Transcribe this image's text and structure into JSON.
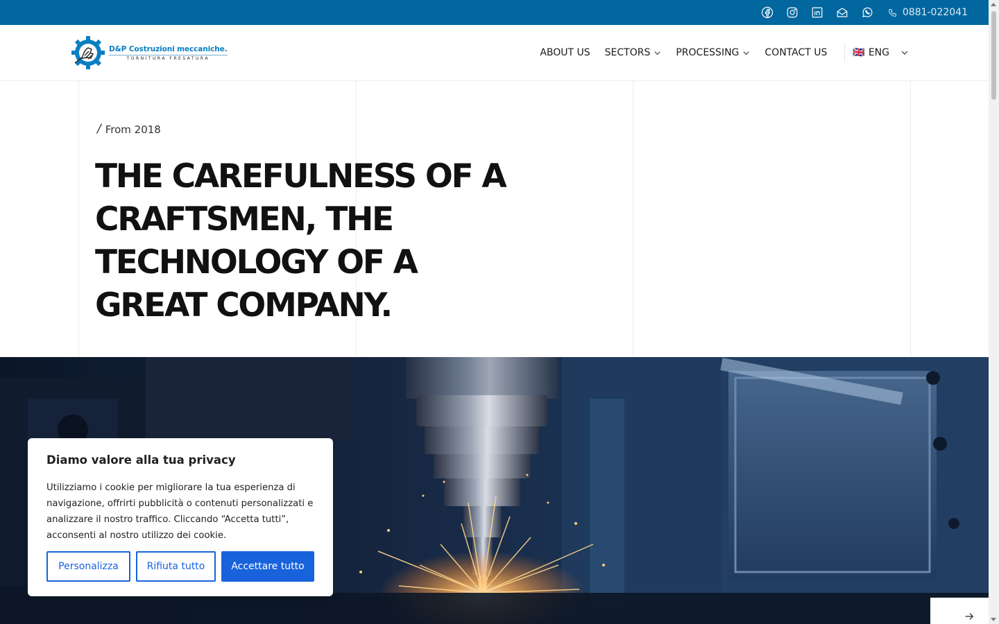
{
  "topbar": {
    "social": [
      "facebook-icon",
      "instagram-icon",
      "linkedin-icon",
      "email-icon",
      "whatsapp-icon"
    ],
    "phone": "0881-022041"
  },
  "header": {
    "logo_brand": "D&P Costruzioni meccaniche.",
    "logo_sub": "TORNITURA  FRESATURA",
    "nav": [
      {
        "label": "ABOUT US",
        "dropdown": false
      },
      {
        "label": "SECTORS",
        "dropdown": true
      },
      {
        "label": "PROCESSING",
        "dropdown": true
      },
      {
        "label": "CONTACT US",
        "dropdown": false
      }
    ],
    "lang_flag": "🇬🇧",
    "lang_label": "ENG"
  },
  "hero": {
    "eyebrow": "From 2018",
    "headline": "THE CAREFULNESS OF A CRAFTSMEN, THE TECHNOLOGY OF A GREAT COMPANY."
  },
  "cookie": {
    "title": "Diamo valore alla tua privacy",
    "body": "Utilizziamo i cookie per migliorare la tua esperienza di navigazione, offrirti pubblicità o contenuti personalizzati e analizzare il nostro traffico. Cliccando “Accetta tutti”, acconsenti al nostro utilizzo dei cookie.",
    "customize": "Personalizza",
    "reject": "Rifiuta tutto",
    "accept": "Accettare tutto"
  },
  "colors": {
    "topbar": "#02679f",
    "cookie_button": "#1863dc"
  }
}
